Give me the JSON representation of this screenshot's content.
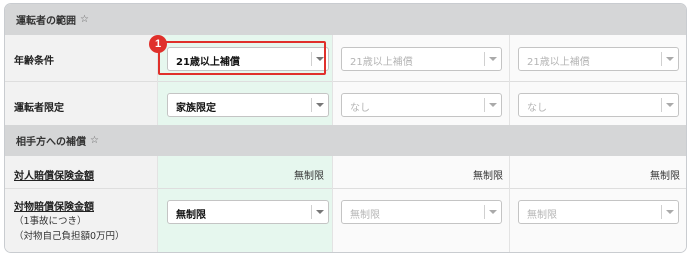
{
  "sections": {
    "driver_scope": {
      "title": "運転者の範囲",
      "star": "☆"
    },
    "compensation": {
      "title": "相手方への補償",
      "star": "☆"
    }
  },
  "rows": {
    "age": {
      "label": "年齢条件",
      "options": [
        "21歳以上補償",
        "21歳以上補償",
        "21歳以上補償"
      ]
    },
    "driver_limit": {
      "label": "運転者限定",
      "options": [
        "家族限定",
        "なし",
        "なし"
      ]
    },
    "bodily": {
      "label": "対人賠償保険金額",
      "values": [
        "無制限",
        "無制限",
        "無制限"
      ]
    },
    "property": {
      "label": "対物賠償保険金額",
      "sub1": "（1事故につき）",
      "sub2": "（対物自己負担額0万円）",
      "options": [
        "無制限",
        "無制限",
        "無制限"
      ]
    }
  },
  "annotation": {
    "badge": "1",
    "color": "#e0302b"
  }
}
